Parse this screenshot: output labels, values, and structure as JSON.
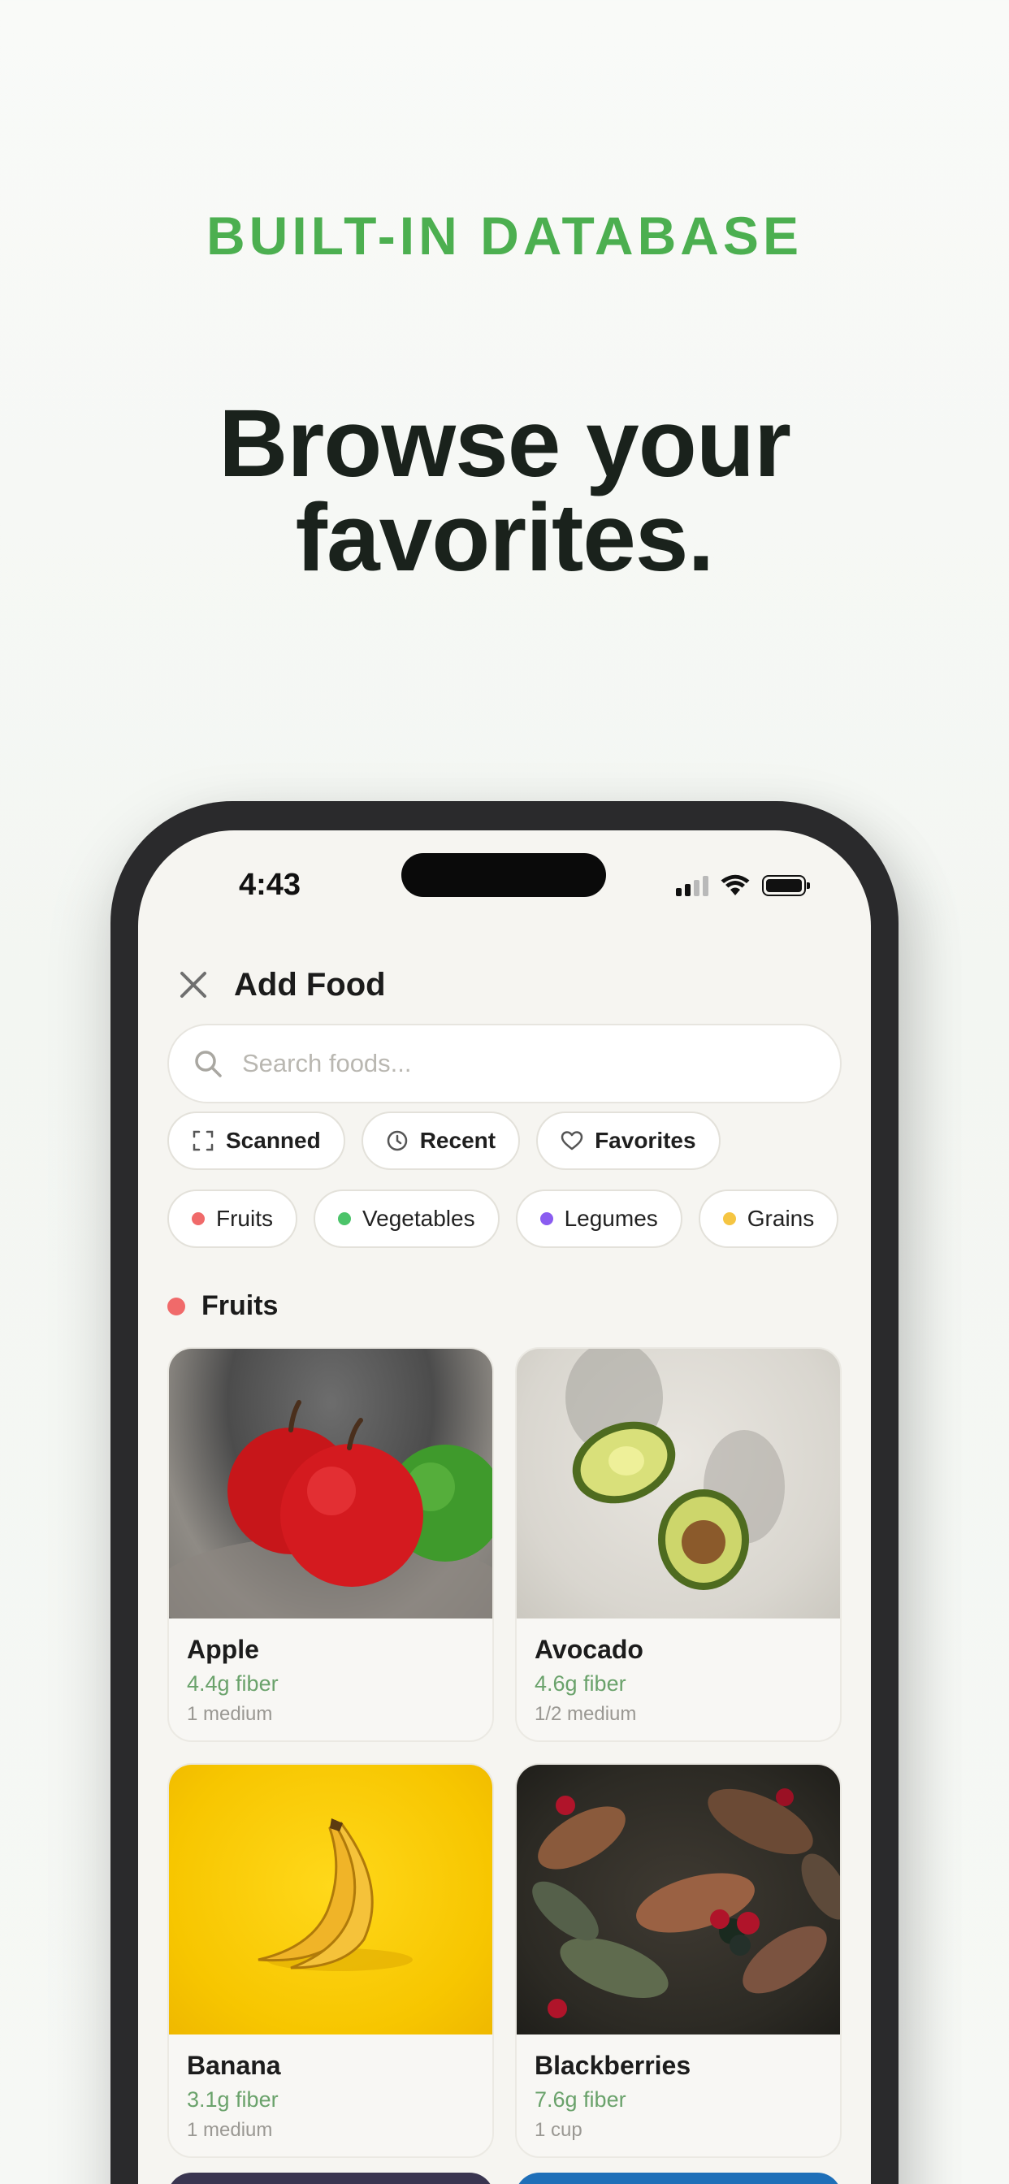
{
  "promo": {
    "eyebrow": "BUILT-IN DATABASE",
    "headline_line1": "Browse your",
    "headline_line2": "favorites."
  },
  "status_bar": {
    "time": "4:43",
    "icons": [
      "cellular-signal-icon",
      "wifi-icon",
      "battery-icon"
    ]
  },
  "header": {
    "close_icon": "close-icon",
    "title": "Add Food"
  },
  "search": {
    "placeholder": "Search foods...",
    "value": "",
    "icon": "search-icon"
  },
  "filters": [
    {
      "label": "Scanned",
      "icon": "scan-icon"
    },
    {
      "label": "Recent",
      "icon": "clock-icon"
    },
    {
      "label": "Favorites",
      "icon": "heart-icon"
    }
  ],
  "categories": [
    {
      "label": "Fruits",
      "color": "#f06a6a"
    },
    {
      "label": "Vegetables",
      "color": "#4cc46a"
    },
    {
      "label": "Legumes",
      "color": "#8a5cf0"
    },
    {
      "label": "Grains",
      "color": "#f5c542"
    }
  ],
  "section": {
    "title": "Fruits",
    "color": "#f06a6a"
  },
  "foods": [
    {
      "name": "Apple",
      "fiber": "4.4g fiber",
      "serving": "1 medium"
    },
    {
      "name": "Avocado",
      "fiber": "4.6g fiber",
      "serving": "1/2 medium"
    },
    {
      "name": "Banana",
      "fiber": "3.1g fiber",
      "serving": "1 medium"
    },
    {
      "name": "Blackberries",
      "fiber": "7.6g fiber",
      "serving": "1 cup"
    }
  ],
  "colors": {
    "accent": "#4caf50",
    "fiber_text": "#6aa26b",
    "headline": "#1a221c"
  }
}
